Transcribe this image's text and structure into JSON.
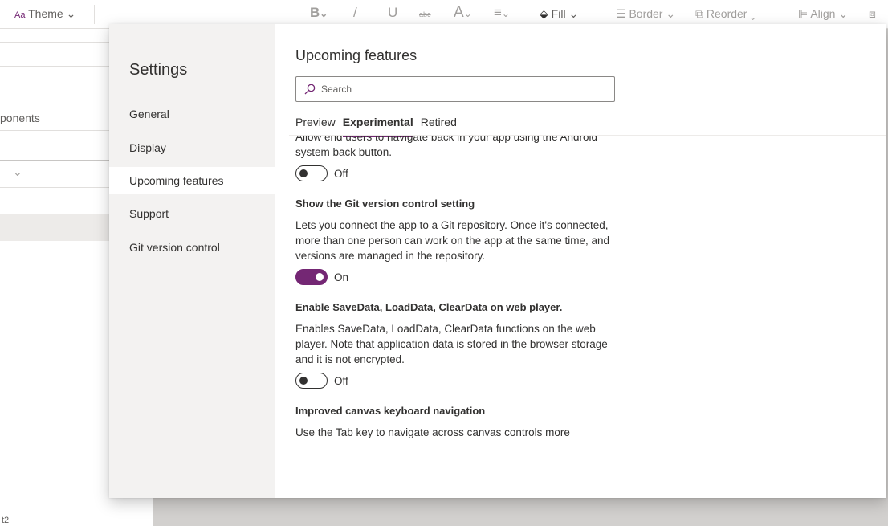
{
  "toolbar": {
    "theme_label": "Theme",
    "bold_label": "B",
    "italic_label": "/",
    "underline_label": "U",
    "strike_label": "abc",
    "font_color_label": "A",
    "align_text_label": "≡",
    "fill_label": "Fill",
    "border_label": "Border",
    "reorder_label": "Reorder",
    "align_label": "Align"
  },
  "background": {
    "components_label": "ponents",
    "bottom_text": "t2"
  },
  "settings": {
    "title": "Settings",
    "nav": [
      {
        "label": "General"
      },
      {
        "label": "Display"
      },
      {
        "label": "Upcoming features"
      },
      {
        "label": "Support"
      },
      {
        "label": "Git version control"
      }
    ]
  },
  "content": {
    "title": "Upcoming features",
    "search_placeholder": "Search",
    "tabs": [
      {
        "label": "Preview"
      },
      {
        "label": "Experimental"
      },
      {
        "label": "Retired"
      }
    ],
    "features": [
      {
        "title": "",
        "description": "Allow end users to navigate back in your app using the Android system back button.",
        "state": "Off"
      },
      {
        "title": "Show the Git version control setting",
        "description": "Lets you connect the app to a Git repository. Once it's connected, more than one person can work on the app at the same time, and versions are managed in the repository.",
        "state": "On"
      },
      {
        "title": "Enable SaveData, LoadData, ClearData on web player.",
        "description": "Enables SaveData, LoadData, ClearData functions on the web player. Note that application data is stored in the browser storage and it is not encrypted.",
        "state": "Off"
      },
      {
        "title": "Improved canvas keyboard navigation",
        "description": "Use the Tab key to navigate across canvas controls more",
        "state": ""
      }
    ]
  },
  "colors": {
    "accent": "#742774",
    "nav_bg": "#f3f2f1"
  }
}
